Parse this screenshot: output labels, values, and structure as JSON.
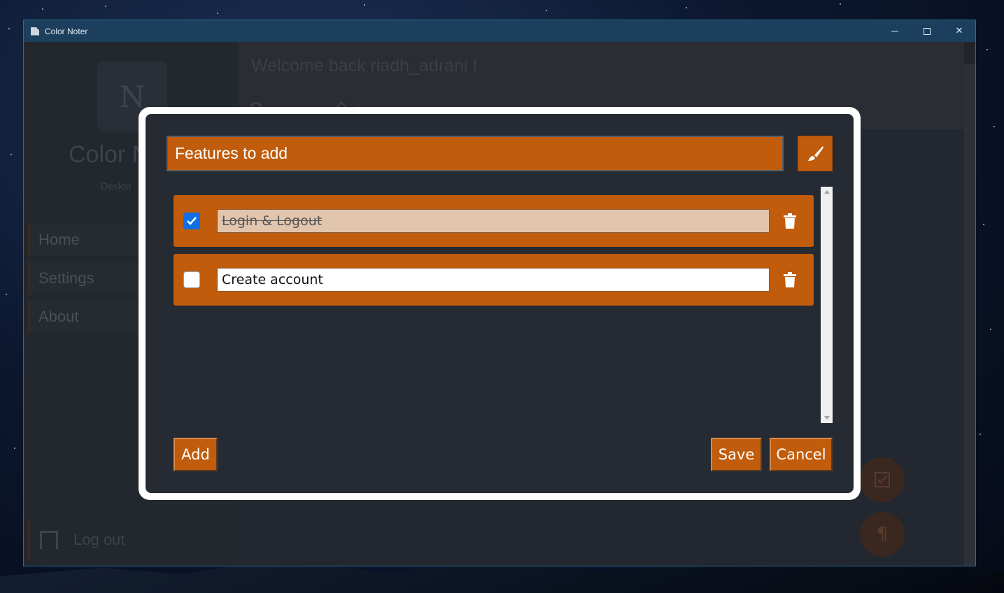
{
  "window": {
    "title": "Color Noter",
    "minimize_glyph": "—",
    "close_glyph": "✕"
  },
  "sidebar": {
    "logo_letter": "N",
    "brand": "Color N",
    "subtitle": "Deskto",
    "items": [
      {
        "label": "Home"
      },
      {
        "label": "Settings"
      },
      {
        "label": "About"
      }
    ],
    "logout_label": "Log out"
  },
  "header": {
    "welcome": "Welcome back riadh_adrani !",
    "search_label": "Search",
    "sort_label": "Sort"
  },
  "dialog": {
    "title": "Features to add",
    "accent_color": "#c05c0b",
    "items": [
      {
        "text": "Login & Logout",
        "checked": true
      },
      {
        "text": "Create account",
        "checked": false
      }
    ],
    "add_label": "Add",
    "save_label": "Save",
    "cancel_label": "Cancel"
  },
  "fabs": {
    "checklist_icon": "checkbox-icon",
    "paragraph_glyph": "¶"
  }
}
